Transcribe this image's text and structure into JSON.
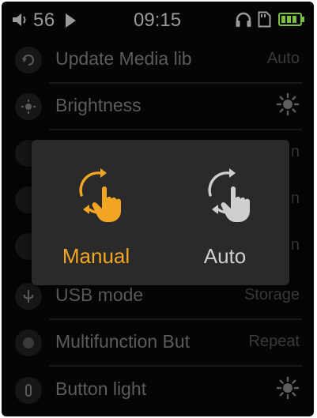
{
  "status_bar": {
    "volume_icon": "speaker-icon",
    "volume": "56",
    "play_icon": "play-icon",
    "time": "09:15",
    "icons": [
      "headphones-icon",
      "sd-card-icon",
      "battery-icon"
    ]
  },
  "settings": {
    "items": [
      {
        "label": "Update Media lib",
        "value": "Auto",
        "icon": "refresh-icon"
      },
      {
        "label": "Brightness",
        "value": "",
        "icon": "sun-icon"
      },
      {
        "label": "",
        "value": "n",
        "icon": "gear-icon"
      },
      {
        "label": "",
        "value": "n",
        "icon": "grid-icon"
      },
      {
        "label": "",
        "value": "n",
        "icon": "clock-icon"
      },
      {
        "label": "USB mode",
        "value": "Storage",
        "icon": "usb-icon"
      },
      {
        "label": "Multifunction But",
        "value": "Repeat",
        "icon": "record-icon"
      },
      {
        "label": "Button light",
        "value": "",
        "icon": "light-icon"
      }
    ]
  },
  "dialog": {
    "options": [
      {
        "label": "Manual",
        "icon": "manual-refresh-icon",
        "selected": true
      },
      {
        "label": "Auto",
        "icon": "auto-refresh-icon",
        "selected": false
      }
    ]
  },
  "colors": {
    "accent": "#f2a623",
    "inactive": "#cfcfcf",
    "background": "#050505",
    "dialog_bg": "#2a2a2a"
  }
}
